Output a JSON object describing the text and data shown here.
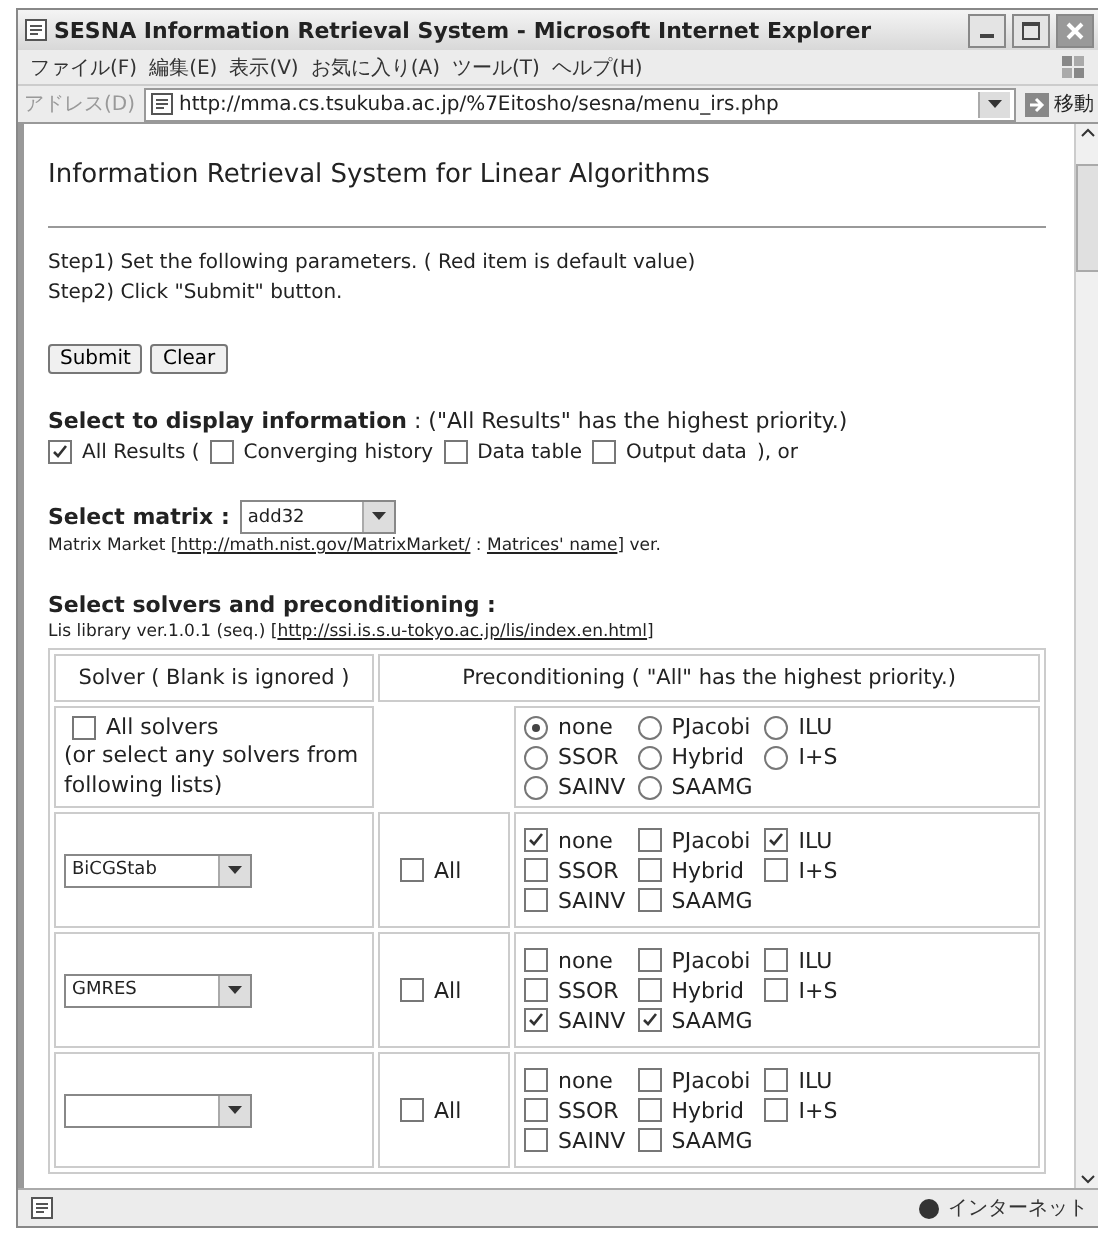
{
  "window": {
    "title": "SESNA Information Retrieval System - Microsoft Internet Explorer"
  },
  "menu": [
    "ファイル(F)",
    "編集(E)",
    "表示(V)",
    "お気に入り(A)",
    "ツール(T)",
    "ヘルプ(H)"
  ],
  "address": {
    "label": "アドレス(D)",
    "value": "http://mma.cs.tsukuba.ac.jp/%7Eitosho/sesna/menu_irs.php",
    "go": "移動"
  },
  "page": {
    "title": "Information Retrieval System for Linear Algorithms",
    "steps": [
      "Step1) Set the following parameters. ( Red item is default value)",
      "Step2) Click \"Submit\" button."
    ],
    "buttons": [
      "Submit",
      "Clear"
    ],
    "display": {
      "heading": "**Select to display information** : (\"All Results\" has the highest priority.)",
      "main": {
        "label": "All Results (",
        "checked": true
      },
      "options": [
        {
          "label": "Converging history",
          "checked": false
        },
        {
          "label": "Data table",
          "checked": false
        },
        {
          "label": "Output data",
          "checked": false
        }
      ],
      "tail": "), or"
    },
    "matrix": {
      "heading": "Select matrix :",
      "value": "add32",
      "source_before": "Matrix Market [",
      "link1": "http://math.nist.gov/MatrixMarket/",
      "middle": " : ",
      "link2": "Matrices' name",
      "source_after": "] ver."
    },
    "solvers": {
      "heading": "Select solvers and preconditioning :",
      "source_before": "Lis library ver.1.0.1 (seq.) [",
      "link": "http://ssi.is.s.u-tokyo.ac.jp/lis/index.en.html",
      "source_after": "]",
      "columns": [
        "Solver ( Blank is ignored )",
        "Preconditioning ( \"All\" has the highest priority.)"
      ],
      "rows": [
        {
          "kind": "radio",
          "all_solvers": {
            "label": "All solvers",
            "checked": false
          },
          "note": "(or select any solvers from following lists)",
          "options": [
            {
              "label": "none",
              "selected": true
            },
            {
              "label": "PJacobi",
              "selected": false
            },
            {
              "label": "ILU",
              "selected": false
            },
            {
              "label": "SSOR",
              "selected": false
            },
            {
              "label": "Hybrid",
              "selected": false
            },
            {
              "label": "I+S",
              "selected": false
            },
            {
              "label": "SAINV",
              "selected": false
            },
            {
              "label": "SAAMG",
              "selected": false
            }
          ]
        },
        {
          "kind": "checkbox",
          "solver": "BiCGStab",
          "all": {
            "label": "All",
            "checked": false
          },
          "options": [
            {
              "label": "none",
              "checked": true
            },
            {
              "label": "PJacobi",
              "checked": false
            },
            {
              "label": "ILU",
              "checked": true
            },
            {
              "label": "SSOR",
              "checked": false
            },
            {
              "label": "Hybrid",
              "checked": false
            },
            {
              "label": "I+S",
              "checked": false
            },
            {
              "label": "SAINV",
              "checked": false
            },
            {
              "label": "SAAMG",
              "checked": false
            }
          ]
        },
        {
          "kind": "checkbox",
          "solver": "GMRES",
          "all": {
            "label": "All",
            "checked": false
          },
          "options": [
            {
              "label": "none",
              "checked": false
            },
            {
              "label": "PJacobi",
              "checked": false
            },
            {
              "label": "ILU",
              "checked": false
            },
            {
              "label": "SSOR",
              "checked": false
            },
            {
              "label": "Hybrid",
              "checked": false
            },
            {
              "label": "I+S",
              "checked": false
            },
            {
              "label": "SAINV",
              "checked": true
            },
            {
              "label": "SAAMG",
              "checked": true
            }
          ]
        },
        {
          "kind": "checkbox",
          "all": {
            "label": "All",
            "checked": false
          },
          "options": [
            {
              "label": "none",
              "checked": false
            },
            {
              "label": "PJacobi",
              "checked": false
            },
            {
              "label": "ILU",
              "checked": false
            },
            {
              "label": "SSOR",
              "checked": false
            },
            {
              "label": "Hybrid",
              "checked": false
            },
            {
              "label": "I+S",
              "checked": false
            },
            {
              "label": "SAINV",
              "checked": false
            },
            {
              "label": "SAAMG",
              "checked": false
            }
          ]
        }
      ]
    }
  },
  "status": {
    "zone": "インターネット"
  }
}
